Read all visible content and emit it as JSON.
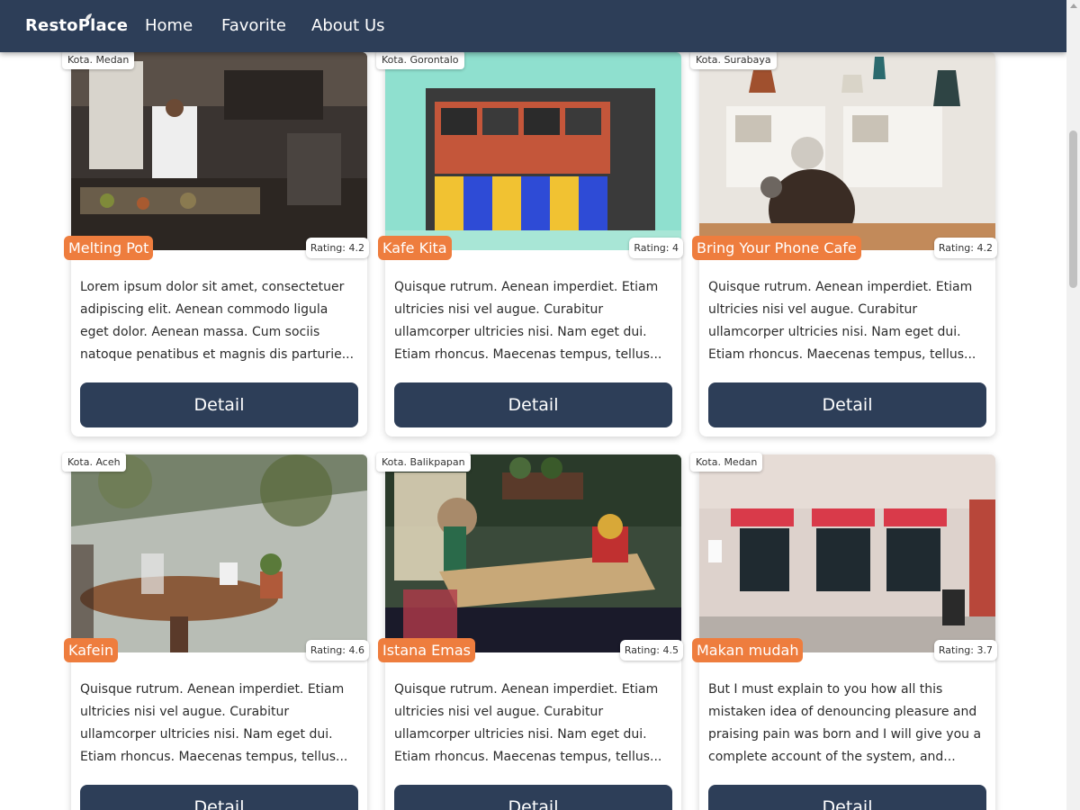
{
  "navbar": {
    "brand": "RestoPlace",
    "links": [
      "Home",
      "Favorite",
      "About Us"
    ]
  },
  "colors": {
    "navbar_bg": "#2d3e58",
    "accent_orange": "#ee7d3e",
    "button_bg": "#2d3e58"
  },
  "restaurants": [
    {
      "city": "Kota. Medan",
      "name": "Melting Pot",
      "rating": "Rating: 4.2",
      "description": "Lorem ipsum dolor sit amet, consectetuer adipiscing elit. Aenean commodo ligula eget dolor. Aenean massa. Cum sociis natoque penatibus et magnis dis parturie...",
      "button": "Detail"
    },
    {
      "city": "Kota. Gorontalo",
      "name": "Kafe Kita",
      "rating": "Rating: 4",
      "description": "Quisque rutrum. Aenean imperdiet. Etiam ultricies nisi vel augue. Curabitur ullamcorper ultricies nisi. Nam eget dui. Etiam rhoncus. Maecenas tempus, tellus...",
      "button": "Detail"
    },
    {
      "city": "Kota. Surabaya",
      "name": "Bring Your Phone Cafe",
      "rating": "Rating: 4.2",
      "description": "Quisque rutrum. Aenean imperdiet. Etiam ultricies nisi vel augue. Curabitur ullamcorper ultricies nisi. Nam eget dui. Etiam rhoncus. Maecenas tempus, tellus...",
      "button": "Detail"
    },
    {
      "city": "Kota. Aceh",
      "name": "Kafein",
      "rating": "Rating: 4.6",
      "description": "Quisque rutrum. Aenean imperdiet. Etiam ultricies nisi vel augue. Curabitur ullamcorper ultricies nisi. Nam eget dui. Etiam rhoncus. Maecenas tempus, tellus...",
      "button": "Detail"
    },
    {
      "city": "Kota. Balikpapan",
      "name": "Istana Emas",
      "rating": "Rating: 4.5",
      "description": "Quisque rutrum. Aenean imperdiet. Etiam ultricies nisi vel augue. Curabitur ullamcorper ultricies nisi. Nam eget dui. Etiam rhoncus. Maecenas tempus, tellus...",
      "button": "Detail"
    },
    {
      "city": "Kota. Medan",
      "name": "Makan mudah",
      "rating": "Rating: 3.7",
      "description": "But I must explain to you how all this mistaken idea of denouncing pleasure and praising pain was born and I will give you a complete account of the system, and...",
      "button": "Detail"
    }
  ]
}
